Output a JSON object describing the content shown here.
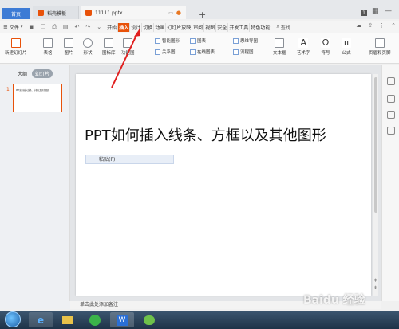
{
  "titlebar": {
    "tabs": {
      "home": "首页",
      "template": "稻壳模板",
      "file": "11111.pptx"
    },
    "new_tab": "+",
    "badge": "1"
  },
  "menubar": {
    "file_menu": "文件",
    "ribbon_tabs": [
      "开始",
      "插入",
      "设计",
      "切换",
      "动画",
      "幻灯片放映",
      "审阅",
      "视图",
      "安全",
      "开发工具",
      "特色功能"
    ],
    "search": "查找"
  },
  "ribbon": {
    "new_slide": "新建幻灯片",
    "table": "表格",
    "picture": "图片",
    "shapes": "形状",
    "icons": "图标库",
    "function_chart": "功能图",
    "smart_art": "智能图形",
    "chart": "图表",
    "mind_map": "思维导图",
    "relation": "关系图",
    "online_chart": "在线图表",
    "flow_chart": "流程图",
    "text_box": "文本框",
    "art_text": "艺术字",
    "symbol": "符号",
    "formula": "公式",
    "header_footer": "页眉和页脚"
  },
  "leftpane": {
    "tab_outline": "大纲",
    "tab_slides": "幻灯片",
    "slide_number": "1",
    "add_slide": "+"
  },
  "slide": {
    "title": "PPT如何插入线条、方框以及其他图形",
    "paste_label": "粘贴(P)"
  },
  "notes": {
    "placeholder": "单击此处添加备注"
  },
  "watermark": "Baidu 经验",
  "colors": {
    "accent": "#e8520a",
    "home_tab": "#3d7bd5"
  }
}
